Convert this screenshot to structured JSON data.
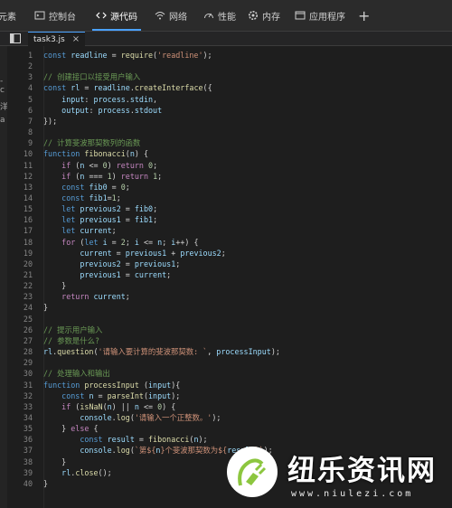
{
  "toolbar": {
    "items": [
      {
        "label": "元素",
        "icon": "elements-icon"
      },
      {
        "label": "控制台",
        "icon": "console-icon"
      },
      {
        "label": "源代码",
        "icon": "sources-icon",
        "active": true
      },
      {
        "label": "网络",
        "icon": "wifi-icon"
      },
      {
        "label": "性能",
        "icon": "performance-icon"
      },
      {
        "label": "内存",
        "icon": "gear-icon"
      },
      {
        "label": "应用程序",
        "icon": "application-icon"
      }
    ],
    "add_label": "+"
  },
  "left_panel_fragments": [
    "-c",
    "洋",
    "a"
  ],
  "tab": {
    "filename": "task3.js",
    "close": "×"
  },
  "editor": {
    "lines": [
      {
        "n": "1",
        "html": "<span class=\"k\">const</span> <span class=\"v\">readline</span> = <span class=\"f\">require</span>(<span class=\"s\">'readline'</span>);"
      },
      {
        "n": "2",
        "html": ""
      },
      {
        "n": "3",
        "html": "<span class=\"c\">// 创建接口以接受用户输入</span>"
      },
      {
        "n": "4",
        "html": "<span class=\"k\">const</span> <span class=\"v\">rl</span> = <span class=\"v\">readline</span>.<span class=\"f\">createInterface</span>({"
      },
      {
        "n": "5",
        "html": "    <span class=\"v\">input</span>: <span class=\"v\">process</span>.<span class=\"v\">stdin</span>,"
      },
      {
        "n": "6",
        "html": "    <span class=\"v\">output</span>: <span class=\"v\">process</span>.<span class=\"v\">stdout</span>"
      },
      {
        "n": "7",
        "html": "});"
      },
      {
        "n": "8",
        "html": ""
      },
      {
        "n": "9",
        "html": "<span class=\"c\">// 计算斐波那契数列的函数</span>"
      },
      {
        "n": "10",
        "html": "<span class=\"k\">function</span> <span class=\"f\">fibonacci</span>(<span class=\"v\">n</span>) {"
      },
      {
        "n": "11",
        "html": "    <span class=\"cf\">if</span> (<span class=\"v\">n</span> &lt;= <span class=\"n\">0</span>) <span class=\"cf\">return</span> <span class=\"n\">0</span>;"
      },
      {
        "n": "12",
        "html": "    <span class=\"cf\">if</span> (<span class=\"v\">n</span> === <span class=\"n\">1</span>) <span class=\"cf\">return</span> <span class=\"n\">1</span>;"
      },
      {
        "n": "13",
        "html": "    <span class=\"k\">const</span> <span class=\"v\">fib0</span> = <span class=\"n\">0</span>;"
      },
      {
        "n": "14",
        "html": "    <span class=\"k\">const</span> <span class=\"v\">fib1</span>=<span class=\"n\">1</span>;"
      },
      {
        "n": "15",
        "html": "    <span class=\"k\">let</span> <span class=\"v\">previous2</span> = <span class=\"v\">fib0</span>;"
      },
      {
        "n": "16",
        "html": "    <span class=\"k\">let</span> <span class=\"v\">previous1</span> = <span class=\"v\">fib1</span>;"
      },
      {
        "n": "17",
        "html": "    <span class=\"k\">let</span> <span class=\"v\">current</span>;"
      },
      {
        "n": "18",
        "html": "    <span class=\"cf\">for</span> (<span class=\"k\">let</span> <span class=\"v\">i</span> = <span class=\"n\">2</span>; <span class=\"v\">i</span> &lt;= <span class=\"v\">n</span>; <span class=\"v\">i</span>++) {"
      },
      {
        "n": "19",
        "html": "        <span class=\"v\">current</span> = <span class=\"v\">previous1</span> + <span class=\"v\">previous2</span>;"
      },
      {
        "n": "20",
        "html": "        <span class=\"v\">previous2</span> = <span class=\"v\">previous1</span>;"
      },
      {
        "n": "21",
        "html": "        <span class=\"v\">previous1</span> = <span class=\"v\">current</span>;"
      },
      {
        "n": "22",
        "html": "    }"
      },
      {
        "n": "23",
        "html": "    <span class=\"cf\">return</span> <span class=\"v\">current</span>;"
      },
      {
        "n": "24",
        "html": "}"
      },
      {
        "n": "25",
        "html": ""
      },
      {
        "n": "26",
        "html": "<span class=\"c\">// 提示用户输入</span>"
      },
      {
        "n": "27",
        "html": "<span class=\"c\">// 参数是什么?</span>"
      },
      {
        "n": "28",
        "html": "<span class=\"v\">rl</span>.<span class=\"f\">question</span>(<span class=\"s\">'请输入要计算的斐波那契数: `</span>, <span class=\"v\">processInput</span>);"
      },
      {
        "n": "29",
        "html": ""
      },
      {
        "n": "30",
        "html": "<span class=\"c\">// 处理输入和输出</span>"
      },
      {
        "n": "31",
        "html": "<span class=\"k\">function</span> <span class=\"f\">processInput</span> (<span class=\"v\">input</span>){"
      },
      {
        "n": "32",
        "html": "    <span class=\"k\">const</span> <span class=\"v\">n</span> = <span class=\"f\">parseInt</span>(<span class=\"v\">input</span>);"
      },
      {
        "n": "33",
        "html": "    <span class=\"cf\">if</span> (<span class=\"f\">isNaN</span>(<span class=\"v\">n</span>) || <span class=\"v\">n</span> &lt;= <span class=\"n\">0</span>) {"
      },
      {
        "n": "34",
        "html": "        <span class=\"v\">console</span>.<span class=\"f\">log</span>(<span class=\"s\">'请输入一个正整数。'</span>);"
      },
      {
        "n": "35",
        "html": "    } <span class=\"cf\">else</span> {"
      },
      {
        "n": "36",
        "html": "        <span class=\"k\">const</span> <span class=\"v\">result</span> = <span class=\"f\">fibonacci</span>(<span class=\"v\">n</span>);"
      },
      {
        "n": "37",
        "html": "        <span class=\"v\">console</span>.<span class=\"f\">log</span>(<span class=\"s\">`第${</span><span class=\"v\">n</span><span class=\"s\">}个斐波那契数为${</span><span class=\"v\">result</span><span class=\"s\">}`</span>);"
      },
      {
        "n": "38",
        "html": "    }"
      },
      {
        "n": "39",
        "html": "    <span class=\"v\">rl</span>.<span class=\"f\">close</span>();"
      },
      {
        "n": "40",
        "html": "}"
      }
    ]
  },
  "watermark": {
    "title": "纽乐资讯网",
    "url": "www.niulezi.com"
  },
  "colors": {
    "accent": "#4aa1ff",
    "background": "#1e1e1e",
    "logo_green": "#8cc63f"
  }
}
